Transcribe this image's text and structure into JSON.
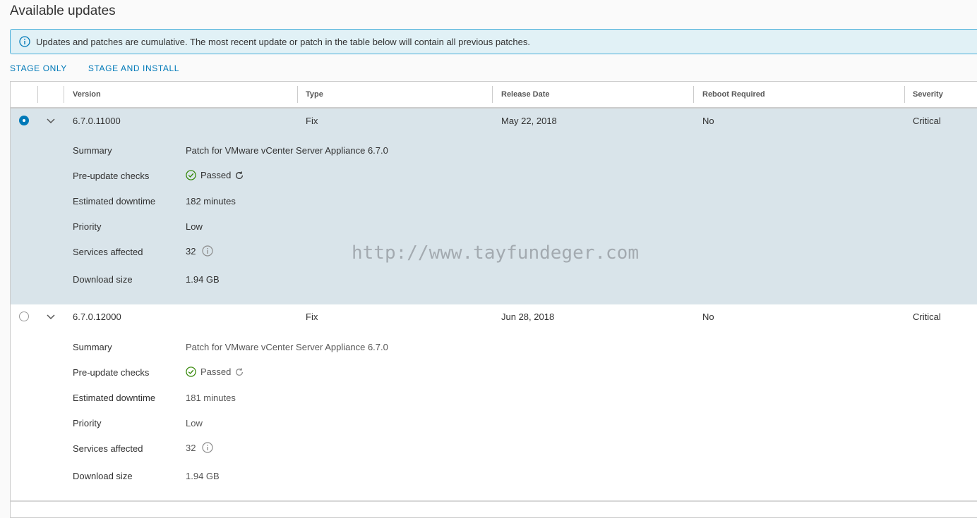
{
  "page": {
    "title": "Available updates"
  },
  "alert": {
    "icon": "info-icon",
    "text": "Updates and patches are cumulative. The most recent update or patch in the table below will contain all previous patches."
  },
  "actions": {
    "stage_only": "STAGE ONLY",
    "stage_and_install": "STAGE AND INSTALL"
  },
  "table": {
    "columns": [
      "Version",
      "Type",
      "Release Date",
      "Reboot Required",
      "Severity"
    ],
    "detail_labels": {
      "summary": "Summary",
      "pre_update_checks": "Pre-update checks",
      "estimated_downtime": "Estimated downtime",
      "priority": "Priority",
      "services_affected": "Services affected",
      "download_size": "Download size"
    },
    "rows": [
      {
        "selected": true,
        "expanded": true,
        "version": "6.7.0.11000",
        "type": "Fix",
        "release_date": "May 22, 2018",
        "reboot_required": "No",
        "severity": "Critical",
        "summary": "Patch for VMware vCenter Server Appliance 6.7.0",
        "pre_update_checks": "Passed",
        "estimated_downtime": "182 minutes",
        "priority": "Low",
        "services_affected": "32",
        "download_size": "1.94 GB"
      },
      {
        "selected": false,
        "expanded": true,
        "version": "6.7.0.12000",
        "type": "Fix",
        "release_date": "Jun 28, 2018",
        "reboot_required": "No",
        "severity": "Critical",
        "summary": "Patch for VMware vCenter Server Appliance 6.7.0",
        "pre_update_checks": "Passed",
        "estimated_downtime": "181 minutes",
        "priority": "Low",
        "services_affected": "32",
        "download_size": "1.94 GB"
      }
    ]
  },
  "watermark": "http://www.tayfundeger.com",
  "colors": {
    "accent": "#0079b8",
    "alert_bg": "#e1f1f6",
    "alert_border": "#49afd9",
    "selected_row": "#d9e4ea",
    "success": "#2f8400"
  }
}
